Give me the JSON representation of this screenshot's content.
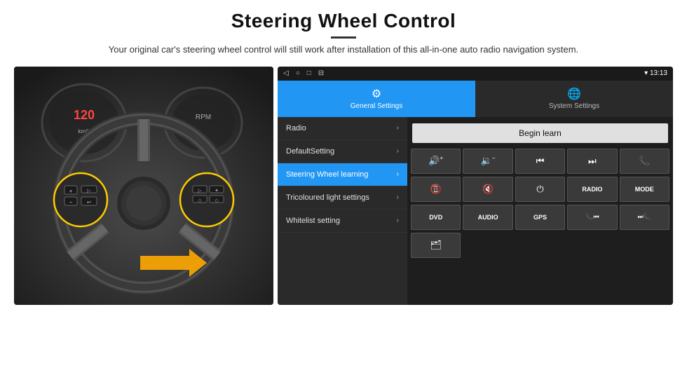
{
  "header": {
    "title": "Steering Wheel Control",
    "subtitle": "Your original car's steering wheel control will still work after installation of this all-in-one auto radio navigation system."
  },
  "statusBar": {
    "time": "13:13",
    "icons": [
      "◁",
      "○",
      "□",
      "⊟"
    ]
  },
  "tabs": [
    {
      "id": "general",
      "label": "General Settings",
      "icon": "⚙",
      "active": true
    },
    {
      "id": "system",
      "label": "System Settings",
      "icon": "🌐",
      "active": false
    }
  ],
  "menuItems": [
    {
      "id": "radio",
      "label": "Radio",
      "active": false
    },
    {
      "id": "default",
      "label": "DefaultSetting",
      "active": false
    },
    {
      "id": "steering",
      "label": "Steering Wheel learning",
      "active": true
    },
    {
      "id": "tricoloured",
      "label": "Tricoloured light settings",
      "active": false
    },
    {
      "id": "whitelist",
      "label": "Whitelist setting",
      "active": false
    }
  ],
  "controls": {
    "beginLearnLabel": "Begin learn",
    "row1": [
      {
        "id": "vol-up",
        "symbol": "🔊+",
        "type": "icon"
      },
      {
        "id": "vol-down",
        "symbol": "🔉−",
        "type": "icon"
      },
      {
        "id": "prev-track",
        "symbol": "⏮",
        "type": "icon"
      },
      {
        "id": "next-track",
        "symbol": "⏭",
        "type": "icon"
      },
      {
        "id": "phone",
        "symbol": "📞",
        "type": "icon"
      }
    ],
    "row2": [
      {
        "id": "hang-up",
        "symbol": "📵",
        "type": "icon"
      },
      {
        "id": "mute",
        "symbol": "🔇",
        "type": "icon"
      },
      {
        "id": "power",
        "symbol": "⏻",
        "type": "icon"
      },
      {
        "id": "radio-btn",
        "symbol": "RADIO",
        "type": "text"
      },
      {
        "id": "mode-btn",
        "symbol": "MODE",
        "type": "text"
      }
    ],
    "row3": [
      {
        "id": "dvd",
        "symbol": "DVD",
        "type": "text"
      },
      {
        "id": "audio",
        "symbol": "AUDIO",
        "type": "text"
      },
      {
        "id": "gps",
        "symbol": "GPS",
        "type": "text"
      },
      {
        "id": "tel-prev",
        "symbol": "📞⏮",
        "type": "icon"
      },
      {
        "id": "tel-next",
        "symbol": "⏭📞",
        "type": "icon"
      }
    ],
    "row4": [
      {
        "id": "folder",
        "symbol": "📁",
        "type": "icon"
      }
    ]
  }
}
